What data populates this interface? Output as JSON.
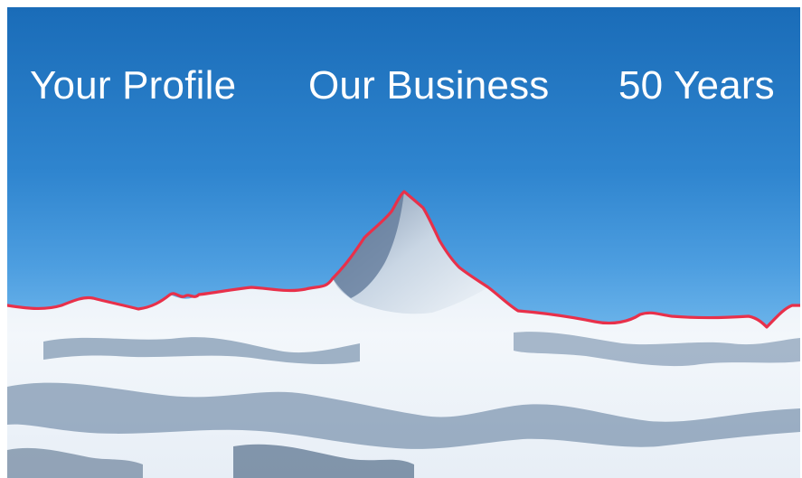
{
  "nav": {
    "items": [
      {
        "label": "Your Profile"
      },
      {
        "label": "Our Business"
      },
      {
        "label": "50 Years"
      }
    ]
  },
  "colors": {
    "sky_top": "#1a6cb8",
    "sky_bottom": "#88c4ef",
    "ridge_line": "#e8304a",
    "snow": "#f4f8fc",
    "rock_shadow": "#4a6a8e"
  }
}
